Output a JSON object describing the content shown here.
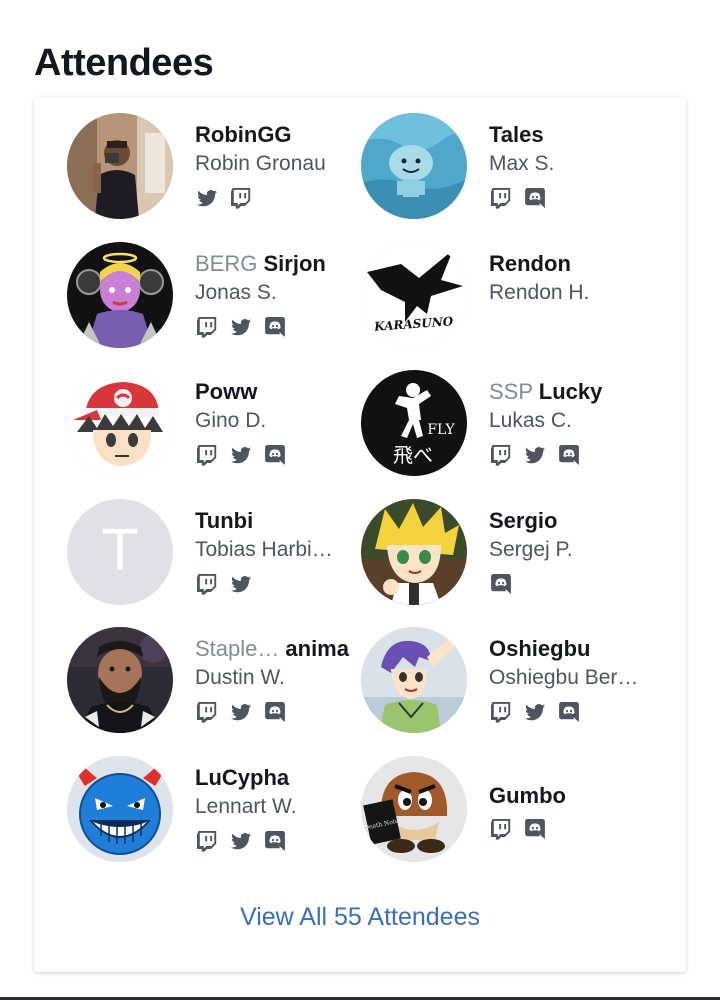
{
  "section": {
    "title": "Attendees"
  },
  "attendees": [
    {
      "tag": "",
      "handle": "RobinGG",
      "name": "Robin Gronau",
      "socials": [
        "twitter",
        "twitch"
      ],
      "avatar": "photo-man"
    },
    {
      "tag": "",
      "handle": "Tales",
      "name": "Max S.",
      "socials": [
        "twitch",
        "discord"
      ],
      "avatar": "water-creature"
    },
    {
      "tag": "BERG",
      "handle": "Sirjon",
      "name": "Jonas S.",
      "socials": [
        "twitch",
        "twitter",
        "discord"
      ],
      "avatar": "anime-angel"
    },
    {
      "tag": "",
      "handle": "Rendon",
      "name": "Rendon H.",
      "socials": [],
      "avatar": "crow-karasuno"
    },
    {
      "tag": "",
      "handle": "Poww",
      "name": "Gino D.",
      "socials": [
        "twitch",
        "twitter",
        "discord"
      ],
      "avatar": "anime-cap-boy"
    },
    {
      "tag": "SSP",
      "handle": "Lucky",
      "name": "Lukas C.",
      "socials": [
        "twitch",
        "twitter",
        "discord"
      ],
      "avatar": "fly-logo"
    },
    {
      "tag": "",
      "handle": "Tunbi",
      "name": "Tobias Harbi…",
      "socials": [
        "twitch",
        "twitter"
      ],
      "avatar": "initial",
      "initial": "T"
    },
    {
      "tag": "",
      "handle": "Sergio",
      "name": "Sergej P.",
      "socials": [
        "discord"
      ],
      "avatar": "anime-blonde"
    },
    {
      "tag": "Staple…",
      "handle": "anima",
      "name": "Dustin W.",
      "socials": [
        "twitch",
        "twitter",
        "discord"
      ],
      "avatar": "photo-bearded"
    },
    {
      "tag": "",
      "handle": "Oshiegbu",
      "name": "Oshiegbu Ber…",
      "socials": [
        "twitch",
        "twitter",
        "discord"
      ],
      "avatar": "anime-purple-hair"
    },
    {
      "tag": "",
      "handle": "LuCypha",
      "name": "Lennart W.",
      "socials": [
        "twitch",
        "twitter",
        "discord"
      ],
      "avatar": "blue-devil"
    },
    {
      "tag": "",
      "handle": "Gumbo",
      "name": "",
      "socials": [
        "twitch",
        "discord"
      ],
      "avatar": "goomba"
    }
  ],
  "view_all": {
    "label": "View All 55 Attendees"
  },
  "avatar_texts": {
    "crow": "KARASUNO",
    "fly": "FLY",
    "fly_kanji": "飛べ",
    "book": "Death Note"
  },
  "colors": {
    "accent": "#3d6fb6",
    "icon": "#4f5560",
    "muted": "#858b96",
    "text": "#14171f"
  }
}
